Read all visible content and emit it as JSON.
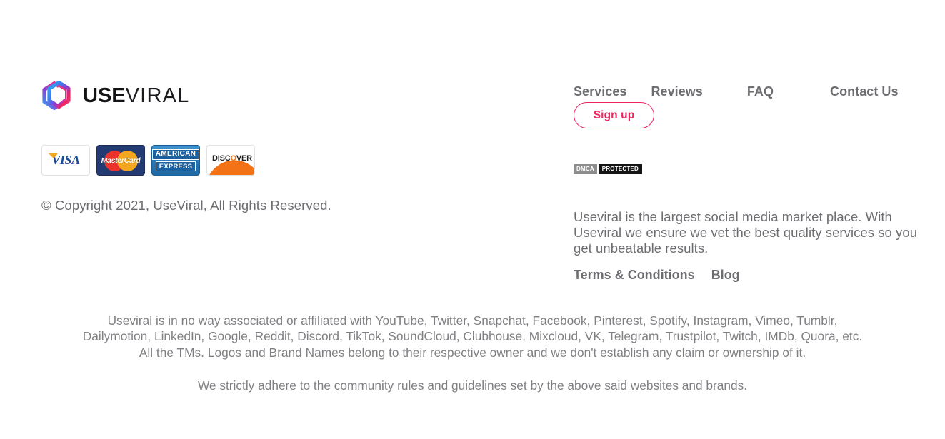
{
  "brand": {
    "logo_icon": "hexagon-ring-logo",
    "name_bold": "USE",
    "name_light": "VIRAL",
    "colors": {
      "hex_blue": "#2ea7f2",
      "hex_pink": "#f0245f",
      "hex_purple": "#8f3bd4",
      "accent": "#f0245f",
      "text_gray": "#6d6e72"
    }
  },
  "payments": {
    "cards": [
      {
        "name": "visa-card-icon",
        "label": "VISA"
      },
      {
        "name": "mastercard-card-icon",
        "label": "MasterCard"
      },
      {
        "name": "american-express-card-icon",
        "label_line1": "AMERICAN",
        "label_line2": "EXPRESS"
      },
      {
        "name": "discover-card-icon",
        "label_pre": "DISC",
        "label_o": "O",
        "label_post": "VER"
      }
    ]
  },
  "copyright": "© Copyright 2021, UseViral, All Rights Reserved.",
  "nav": {
    "items": [
      {
        "label": "Services",
        "name": "nav-link-services"
      },
      {
        "label": "Reviews",
        "name": "nav-link-reviews"
      },
      {
        "label": "FAQ",
        "name": "nav-link-faq"
      },
      {
        "label": "Contact Us",
        "name": "nav-link-contact-us"
      }
    ],
    "signup_label": "Sign up"
  },
  "dmca": {
    "left_label": "DMCA",
    "right_label": "PROTECTED"
  },
  "description": "Useviral is the largest social media market place. With Useviral we ensure we vet the best quality services so you get unbeatable results.",
  "footer_links": [
    {
      "label": "Terms & Conditions",
      "name": "footer-link-terms-and-conditions"
    },
    {
      "label": "Blog",
      "name": "footer-link-blog"
    }
  ],
  "disclaimer": {
    "main": "Useviral is in no way associated or affiliated with YouTube, Twitter, Snapchat, Facebook, Pinterest, Spotify, Instagram, Vimeo, Tumblr, Dailymotion, LinkedIn, Google, Reddit, Discord, TikTok, SoundCloud, Clubhouse, Mixcloud, VK, Telegram, Trustpilot, Twitch, IMDb, Quora, etc. All the TMs. Logos and Brand Names belong to their respective owner and we don't establish any claim or ownership of it.",
    "note": "We strictly adhere to the community rules and guidelines set by the above said websites and brands."
  }
}
